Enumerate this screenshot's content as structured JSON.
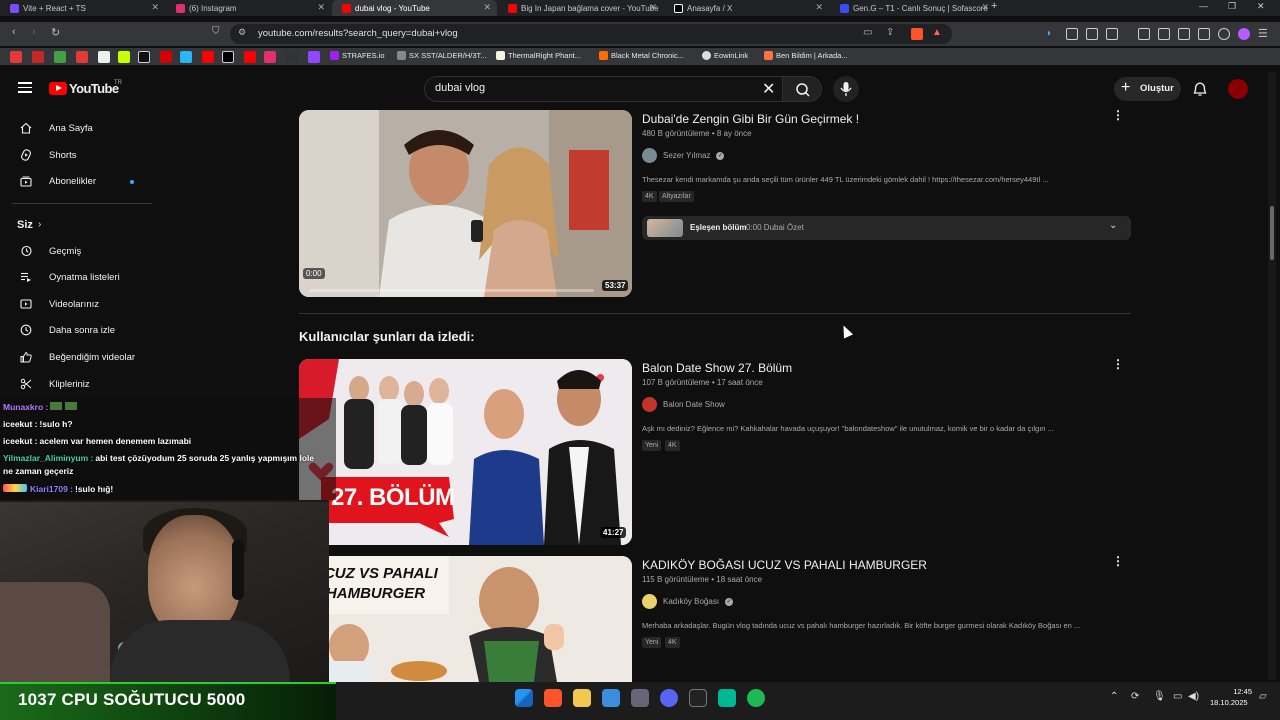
{
  "browser": {
    "tabs": [
      {
        "title": "Vite + React + TS",
        "color": "#7c4dff"
      },
      {
        "title": "(6) Instagram",
        "color": "#e1306c"
      },
      {
        "title": "dubai vlog - YouTube",
        "color": "#ff0000"
      },
      {
        "title": "Big In Japan bağlama cover - YouTube",
        "color": "#ff0000"
      },
      {
        "title": "Anasayfa / X",
        "color": "#ffffff"
      },
      {
        "title": "Gen.G – T1 - Canlı Sonuç | Sofascore",
        "color": "#374df5"
      }
    ],
    "new_tab": "+",
    "url": "youtube.com/results?search_query=dubai+vlog",
    "bookmarks": [
      {
        "label": "STRAFES.io",
        "color": "#a020f0"
      },
      {
        "label": "SX SST/ALDER/H/3T...",
        "color": "#888888"
      },
      {
        "label": "ThermalRight Phant...",
        "color": "#f5f5dc"
      },
      {
        "label": "Black Metal Chronic...",
        "color": "#ff6d00"
      },
      {
        "label": "EowinLink",
        "color": "#dddddd"
      },
      {
        "label": "Ben Bildim | Arkada...",
        "color": "#ff7043"
      }
    ]
  },
  "youtube": {
    "logo": "YouTube",
    "country": "TR",
    "search_value": "dubai vlog",
    "create_label": "Oluştur",
    "sidebar": {
      "items": [
        {
          "label": "Ana Sayfa",
          "icon": "home-icon"
        },
        {
          "label": "Shorts",
          "icon": "shorts-icon"
        },
        {
          "label": "Abonelikler",
          "icon": "subscriptions-icon"
        }
      ],
      "you_label": "Siz",
      "you_items": [
        {
          "label": "Geçmiş",
          "icon": "history-icon"
        },
        {
          "label": "Oynatma listeleri",
          "icon": "playlist-icon"
        },
        {
          "label": "Videolarınız",
          "icon": "your-videos-icon"
        },
        {
          "label": "Daha sonra izle",
          "icon": "watch-later-icon"
        },
        {
          "label": "Beğendiğim videolar",
          "icon": "like-icon"
        },
        {
          "label": "Klipleriniz",
          "icon": "clips-icon"
        }
      ]
    },
    "videos": [
      {
        "title": "Dubai'de Zengin Gibi Bir Gün Geçirmek !",
        "meta": "480 B görüntüleme • 8 ay önce",
        "channel": "Sezer Yılmaz",
        "verified": true,
        "desc": "Thesezar kendi markamda şu anda seçili tüm ürünler 449 TL üzerimdeki gömlek dahil ! https://thesezar.com/hersey449tl ...",
        "badges": [
          "4K",
          "Altyazılar"
        ],
        "duration": "53:37",
        "progress_time": "0:00",
        "chapter_label": "Eşleşen bölüm",
        "chapter_time": "0:00 Dubai Özet"
      },
      {
        "title": "Balon Date Show 27. Bölüm",
        "meta": "107 B görüntüleme • 17 saat önce",
        "channel": "Balon Date Show",
        "verified": false,
        "desc": "Aşk mı dediniz? Eğlence mi? Kahkahalar havada uçuşuyor! \"balondateshow\" ile unutulmaz, komik ve bir o kadar da çılgın ...",
        "badges": [
          "Yeni",
          "4K"
        ],
        "duration": "41:27",
        "thumb_text": "27. BÖLÜM"
      },
      {
        "title": "KADIKÖY BOĞASI UCUZ VS PAHALI HAMBURGER",
        "meta": "115 B görüntüleme • 18 saat önce",
        "channel": "Kadıköy Boğası",
        "verified": true,
        "desc": "Merhaba arkadaşlar. Bugün vlog tadında ucuz vs pahalı hamburger hazırladık. Bir köfte burger gurmesi olarak Kadıköy Boğası en ...",
        "badges": [
          "Yeni",
          "4K"
        ],
        "thumb_text": "UCUZ VS PAHALI HAMBURGER"
      }
    ],
    "section_title": "Kullanıcılar şunları da izledi:"
  },
  "stream": {
    "chat": [
      {
        "nick": "Munaxkro :",
        "msg": "",
        "nick_color": "#b97aff"
      },
      {
        "nick": "iceekut :",
        "msg": "!sulo h?",
        "nick_color": "#ffffff"
      },
      {
        "nick": "iceekut :",
        "msg": "acelem var hemen denemem lazımabi",
        "nick_color": "#ffffff"
      },
      {
        "nick": "Yilmazlar_Aliminyum :",
        "msg": "abi test çözüyodum 25 soruda 25 yanlış yapmışım lole",
        "nick_color": "#3ed6a5"
      },
      {
        "nick": "",
        "msg": "ne zaman geçeriz",
        "nick_color": "#ffffff"
      },
      {
        "nick": "Kiari1709 :",
        "msg": "!sulo hığ!",
        "nick_color": "#9a7bff"
      }
    ],
    "cpu_label": "1037 CPU SOĞUTUCU 5000"
  },
  "tray": {
    "time": "12:45",
    "date": "18.10.2025"
  }
}
